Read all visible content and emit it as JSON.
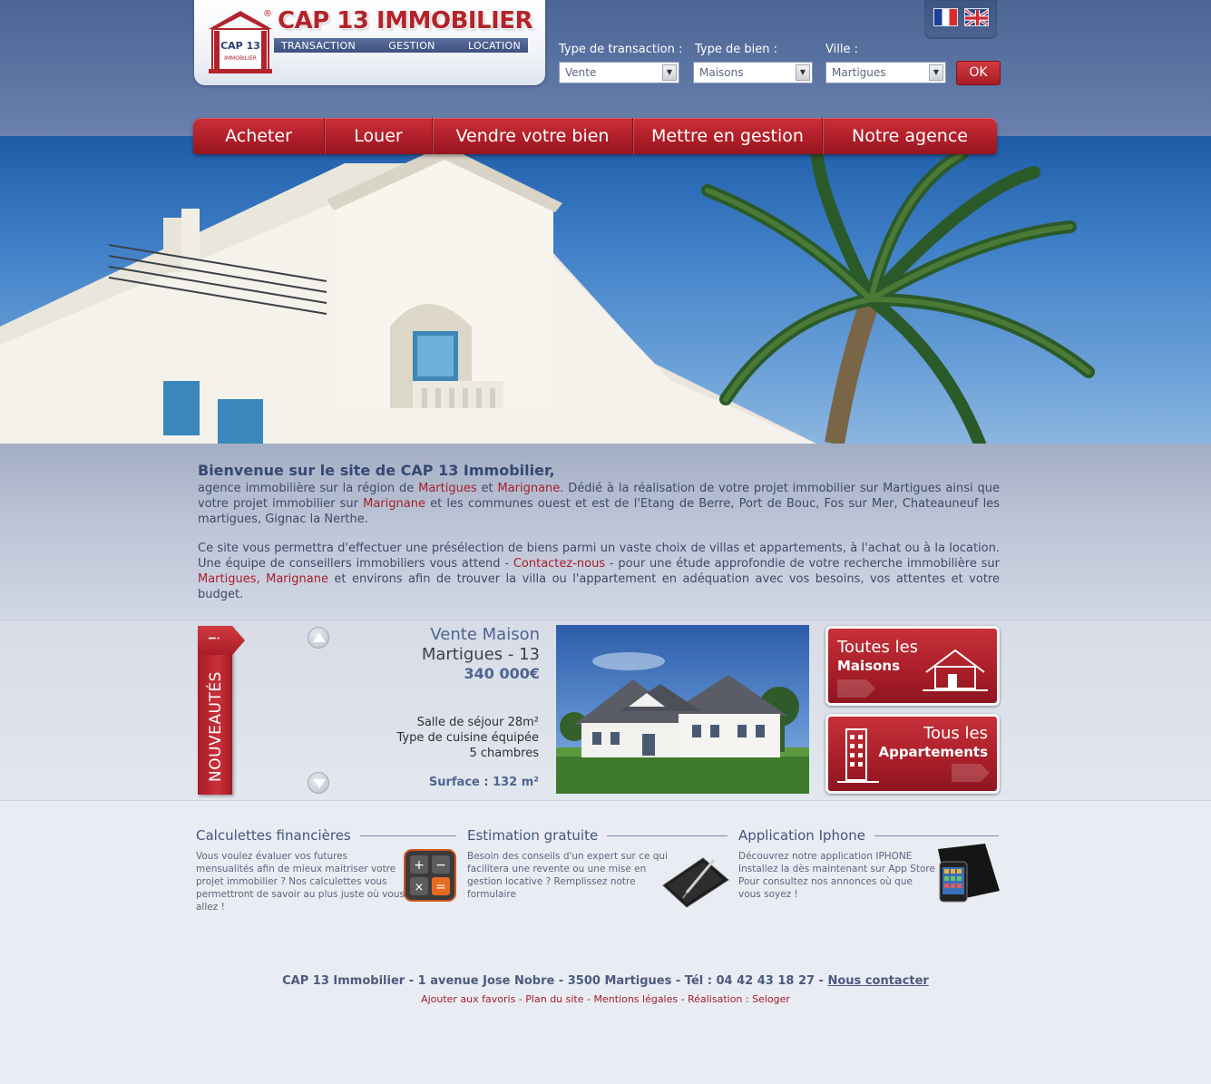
{
  "header": {
    "logo_title": "CAP 13 IMMOBILIER",
    "logo_reg": "®",
    "logo_emblem_text": "CAP 13",
    "logo_emblem_sub": "IMMOBILIER",
    "logo_band": [
      "TRANSACTION",
      "GESTION",
      "LOCATION"
    ],
    "languages": [
      "fr-flag-icon",
      "uk-flag-icon"
    ]
  },
  "search": {
    "transaction_label": "Type de transaction :",
    "transaction_value": "Vente",
    "property_label": "Type de bien :",
    "property_value": "Maisons",
    "city_label": "Ville :",
    "city_value": "Martigues",
    "submit_label": "OK"
  },
  "nav": {
    "items": [
      "Acheter",
      "Louer",
      "Vendre votre bien",
      "Mettre en gestion",
      "Notre agence"
    ]
  },
  "intro": {
    "title": "Bienvenue sur le site de CAP 13 Immobilier,",
    "p1": {
      "t1": "agence immobilière sur la région de ",
      "l1": "Martigues",
      "t2": " et ",
      "l2": "Marignane",
      "t3": ". Dédié à la réalisation de votre projet immobilier sur Martigues ainsi que votre projet immobilier sur ",
      "l3": "Marignane",
      "t4": " et les communes ouest et est de l'Etang de Berre, Port de Bouc, Fos sur Mer, Chateauneuf les martigues, Gignac la Nerthe."
    },
    "p2": {
      "t1": "Ce site vous permettra d'effectuer une présélection de biens parmi un vaste choix de villas et appartements, à l'achat ou à la location. Une équipe de conseillers immobiliers vous attend - ",
      "l1": "Contactez-nous",
      "t2": " - pour une étude approfondie de votre recherche immobilière sur ",
      "l2": "Martigues, Marignane",
      "t3": " et environs afin de trouver la villa ou l'appartement en adéquation avec vos besoins, vos attentes et votre budget."
    }
  },
  "news": {
    "ribbon_label": "NOUVEAUTÉS",
    "ribbon_mark": "!",
    "listing": {
      "title": "Vente Maison",
      "city": "Martigues - 13",
      "price": "340 000€",
      "features": [
        "Salle de séjour 28m²",
        "Type de cuisine équipée",
        "5 chambres"
      ],
      "surface": "Surface : 132 m²"
    },
    "cta_houses": {
      "line1": "Toutes les",
      "line2": "Maisons"
    },
    "cta_apartments": {
      "line1": "Tous les",
      "line2": "Appartements"
    }
  },
  "services": [
    {
      "title": "Calculettes financières",
      "text": "Vous voulez évaluer vos futures mensualités afin de mieux maitriser votre projet immobilier ? Nos calculettes vous permettront de savoir au plus juste où vous allez !"
    },
    {
      "title": "Estimation gratuite",
      "text": "Besoin des conseils d'un expert sur ce qui facilitera une revente ou une mise en gestion locative ? Remplissez notre formulaire"
    },
    {
      "title": "Application Iphone",
      "text": "Découvrez notre application IPHONE Installez la dès maintenant sur App Store Pour consultez nos annonces où que vous soyez !"
    }
  ],
  "footer": {
    "address": "CAP 13 Immobilier -  1 avenue Jose Nobre - 3500 Martigues - Tél : 04 42 43 18 27  - ",
    "contact_link": "Nous contacter",
    "links": [
      "Ajouter aux favoris",
      "Plan du site",
      "Mentions légales",
      "Réalisation : Seloger"
    ],
    "separator": " - "
  },
  "colors": {
    "brand_red": "#b3232b",
    "header_blue": "#4d6595",
    "text_blue": "#344872"
  }
}
